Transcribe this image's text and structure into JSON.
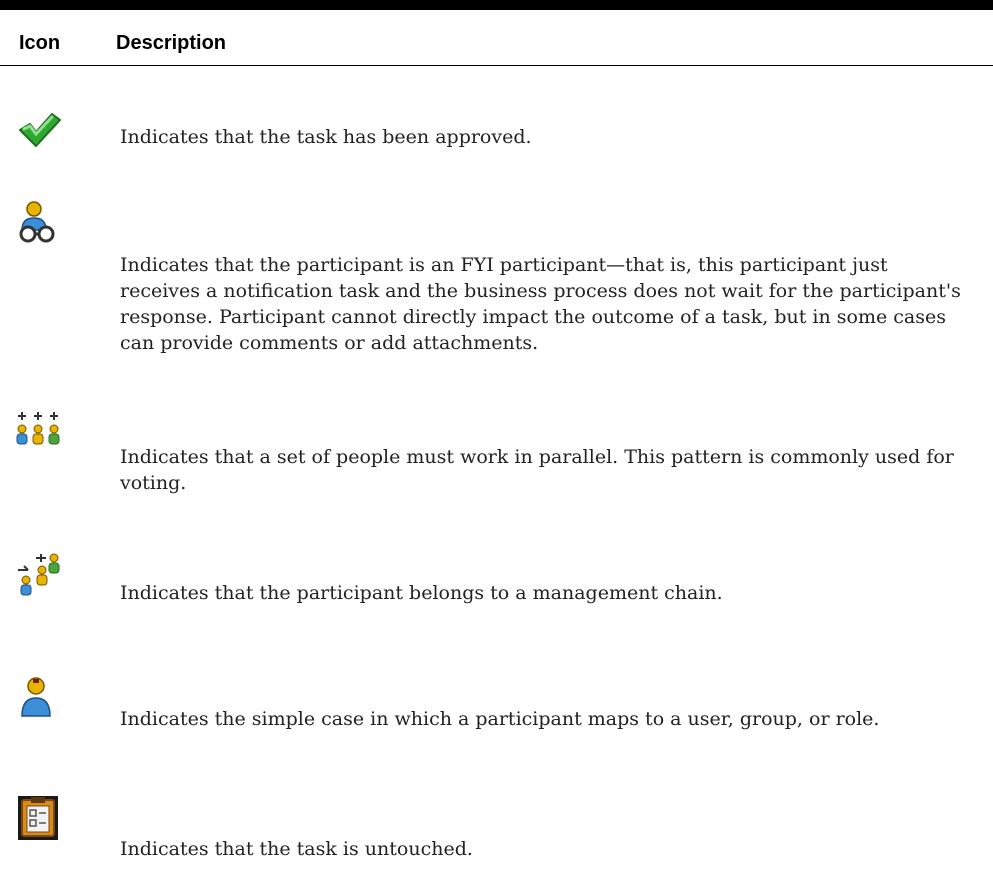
{
  "table": {
    "headers": {
      "icon": "Icon",
      "description": "Description"
    },
    "rows": [
      {
        "icon": "green-checkmark-icon",
        "description": "Indicates that the task has been approved."
      },
      {
        "icon": "fyi-participant-icon",
        "description": "Indicates that the participant is an FYI participant—that is, this participant just receives a notification task and the business process does not wait for the participant's response. Participant cannot directly impact the outcome of a task, but in some cases can provide comments or add attachments."
      },
      {
        "icon": "parallel-participants-icon",
        "description": "Indicates that a set of people must work in parallel. This pattern is commonly used for voting."
      },
      {
        "icon": "management-chain-icon",
        "description": "Indicates that the participant belongs to a management chain."
      },
      {
        "icon": "single-participant-icon",
        "description": "Indicates the simple case in which a participant maps to a user, group, or role."
      },
      {
        "icon": "untouched-task-clipboard-icon",
        "description": "Indicates that the task is untouched."
      }
    ]
  },
  "colors": {
    "rule": "#000000",
    "text": "#222222",
    "check_green": "#2fa82f",
    "person_blue": "#3a8fd8",
    "person_yellow": "#e8b400",
    "person_green": "#4aa53a",
    "clipboard_brown": "#7a4a10",
    "clipboard_orange": "#d98a1a"
  }
}
